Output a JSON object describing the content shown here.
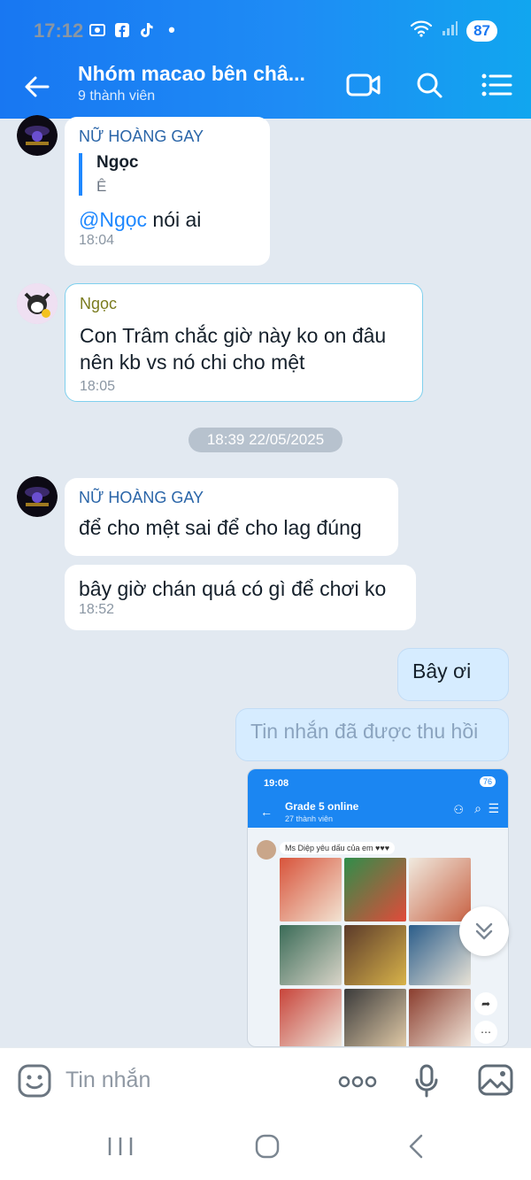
{
  "status": {
    "time": "17:12",
    "battery": "87"
  },
  "header": {
    "title": "Nhóm macao bên châ...",
    "subtitle": "9 thành viên"
  },
  "messages": {
    "m1": {
      "sender": "NỮ HOÀNG GAY",
      "quote_name": "Ngọc",
      "quote_text": "Ê",
      "mention": "@Ngọc",
      "text": " nói ai",
      "time": "18:04"
    },
    "m2": {
      "sender": "Ngọc",
      "line1": "Con Trâm chắc giờ này ko on đâu",
      "line2": "nên kb vs nó chi cho mệt",
      "time": "18:05"
    },
    "date_chip": "18:39 22/05/2025",
    "m3": {
      "sender": "NỮ HOÀNG GAY",
      "text": "để cho mệt sai để cho lag đúng"
    },
    "m4": {
      "text": "bây giờ chán quá có gì để chơi ko",
      "time": "18:52"
    },
    "mine1": {
      "text": "Bây ơi"
    },
    "mine2": {
      "text": "Tin nhắn đã được thu hồi"
    }
  },
  "shared_screenshot": {
    "time": "19:08",
    "battery": "76",
    "title": "Grade 5 online",
    "subtitle": "27 thành viên",
    "message": "Ms Diệp yêu dấu của em ♥♥♥"
  },
  "composer": {
    "placeholder": "Tin nhắn"
  },
  "colors": {
    "header_start": "#1877f2",
    "header_end": "#11a6ef",
    "chat_bg": "#e2e9f1",
    "mine_bubble": "#d6ecff"
  }
}
